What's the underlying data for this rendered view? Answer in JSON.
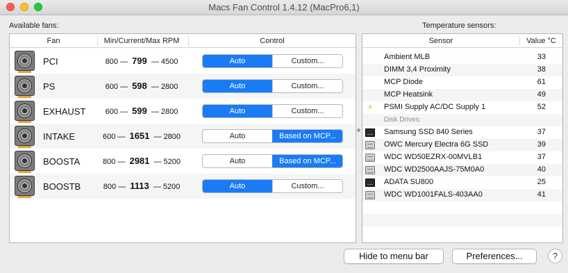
{
  "window": {
    "title": "Macs Fan Control 1.4.12 (MacPro6,1)"
  },
  "labels": {
    "available_fans": "Available fans:",
    "temperature_sensors": "Temperature sensors:"
  },
  "fans_table": {
    "headers": {
      "fan": "Fan",
      "rpm": "Min/Current/Max RPM",
      "control": "Control"
    },
    "rows": [
      {
        "name": "PCI",
        "min": "800",
        "current": "799",
        "max": "4500",
        "auto": "Auto",
        "custom": "Custom...",
        "mode": "auto"
      },
      {
        "name": "PS",
        "min": "600",
        "current": "598",
        "max": "2800",
        "auto": "Auto",
        "custom": "Custom...",
        "mode": "auto"
      },
      {
        "name": "EXHAUST",
        "min": "600",
        "current": "599",
        "max": "2800",
        "auto": "Auto",
        "custom": "Custom...",
        "mode": "auto"
      },
      {
        "name": "INTAKE",
        "min": "600",
        "current": "1651",
        "max": "2800",
        "auto": "Auto",
        "custom": "Based on MCP...",
        "mode": "custom"
      },
      {
        "name": "BOOSTA",
        "min": "800",
        "current": "2981",
        "max": "5200",
        "auto": "Auto",
        "custom": "Based on MCP...",
        "mode": "custom"
      },
      {
        "name": "BOOSTB",
        "min": "800",
        "current": "1113",
        "max": "5200",
        "auto": "Auto",
        "custom": "Custom...",
        "mode": "auto"
      }
    ]
  },
  "sensors_table": {
    "headers": {
      "sensor": "Sensor",
      "value": "Value °C"
    },
    "sensors": [
      {
        "name": "Ambient MLB",
        "value": "33",
        "icon": "none"
      },
      {
        "name": "DIMM 3,4 Proximity",
        "value": "38",
        "icon": "none"
      },
      {
        "name": "MCP Diode",
        "value": "61",
        "icon": "none"
      },
      {
        "name": "MCP Heatsink",
        "value": "49",
        "icon": "none"
      },
      {
        "name": "PSMI Supply AC/DC Supply 1",
        "value": "52",
        "icon": "lightning-icon"
      }
    ],
    "disk_group_label": "Disk Drives:",
    "disks": [
      {
        "name": "Samsung SSD 840 Series",
        "value": "37",
        "icon": "ssd-icon"
      },
      {
        "name": "OWC Mercury Electra 6G SSD",
        "value": "39",
        "icon": "drive-icon"
      },
      {
        "name": "WDC WD50EZRX-00MVLB1",
        "value": "37",
        "icon": "hdd-icon"
      },
      {
        "name": "WDC WD2500AAJS-75M0A0",
        "value": "40",
        "icon": "hdd-icon"
      },
      {
        "name": "ADATA SU800",
        "value": "25",
        "icon": "ssd-icon"
      },
      {
        "name": "WDC WD1001FALS-403AA0",
        "value": "41",
        "icon": "hdd-icon"
      }
    ]
  },
  "buttons": {
    "hide": "Hide to menu bar",
    "preferences": "Preferences...",
    "help": "?"
  },
  "colors": {
    "accent": "#1a7cf5",
    "warning_icon": "#e0a800"
  }
}
